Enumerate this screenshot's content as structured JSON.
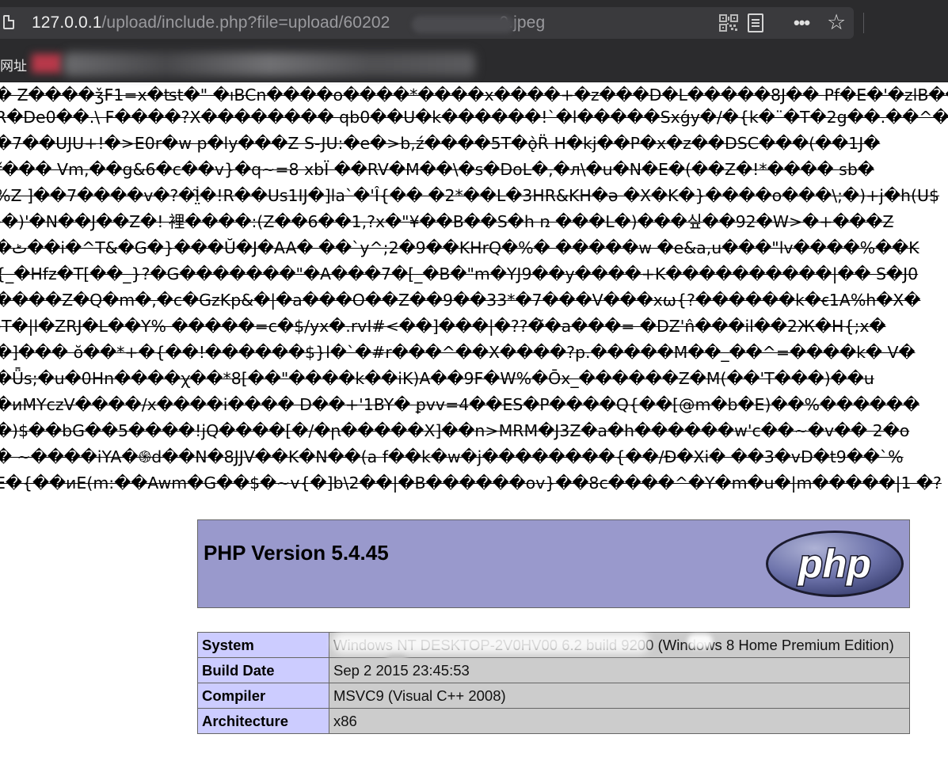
{
  "browser": {
    "url_host": "127.0.0.1",
    "url_path": "/upload/include.php?file=upload/60202",
    "url_suffix": "0.jpeg",
    "bookmarks_label": "网址",
    "more_glyph": "•••",
    "star_glyph": "☆"
  },
  "garbage_lines": [
    "� Z����ǯF1=x�ʦt�\" �ıBCn����o����*����x����+�z���D�L�����8J�� Pf�E�'�zlB����ZO",
    "R�De0��.\\ F����?X�������� qb0��U�k������!`�l�����Sxǵy�/�{k�¨�T�2g��.��^�",
    "�7��UJU+!�>E0r�w p�ly���Z S-JU:�e�>b,ź����5T�ǫ̀R̈ H�kj��P�x�z��DSC���(��1J�",
    "ř��� Vm,��g&6�c��v}�q~=8 xbÏ ��RV�M��\\�s�DoL�,�л\\�u�N�E�(��Z�!*���� sb�",
    "%Z ]��7����v�?�İ̤̃�!R��Us1IJ�]la`�'Î{�� �2*��L�3HR&KH�ə �X�K�}����o���\\;�)+j�h(U$",
    ")�)'�N��J��Z�! 裡����:(Z��6��1,?x�\"¥��B��S�h ռ ���L�)���싶��92�W>�+���Z",
    "�ٹ��i�^T&�G�}���Ŭ�J�AA� ��`y^;2�9��KHrQ�%� �����w �e&a,u���\"lv����%��K",
    "{_�Hfz�T[��_}?�G�������\"�A���7�[_�B�\"m�YJ9��y����+K����������|�� S�J0",
    "����Z�Q�m�,�c�GzKp&�|�a���O��Z��9��33*�7���V���xω{?������k�ꞓ1A%h�X�",
    ")T�|l�ZRJ�L��Y% �����=c�$/yx�.rvI#<��]���|�??�̃�a���= �DZ'n̂���il��2Ж�H{;x�",
    "�]��� ŏ��*+�{��!������$}l�`�#r���^��X����?p.�����M��_��^=����k� V�",
    "�Ǖs;�u�0Hn����ꭓ��*8[��\"����k��iK)A��9F�W%�Ōx_������Z�M(��'T���)��u",
    "�ᴎMYczV����/x����i���� D��+'1BY� ꝑvv=4��ES�P����Q{��[@m�b�E)��%������",
    "�)$��bG��5����!jQ����[�/�ꞃ�����X]��n>MRM�J3Z�a�h������w'c��~�v�� 2�o",
    "� ~����iYA�֍d��N�8JJV��K�N��(a f��k�w�j��������{��/Ɖ�Xi� ��3�vD�t9��`%",
    "E�{��иE(m:��Awm�G��$�~v{�]b\\2��|�B������ov}��8c����^�Y�m�u�|m�����|1 �?"
  ],
  "php_header": {
    "title": "PHP Version 5.4.45",
    "logo_text": "php"
  },
  "info_rows": [
    {
      "label": "System",
      "value": "Windows NT DESKTOP-2V0HV00 6.2 build 9200 (Windows 8 Home Premium Edition)"
    },
    {
      "label": "Build Date",
      "value": "Sep 2 2015 23:45:53"
    },
    {
      "label": "Compiler",
      "value": "MSVC9 (Visual C++ 2008)"
    },
    {
      "label": "Architecture",
      "value": "x86"
    }
  ],
  "colors": {
    "chrome_bg": "#2b2b2d",
    "urlbar_bg": "#3a3a3d",
    "php_header_bg": "#9999cc",
    "label_cell_bg": "#ccccff",
    "value_cell_bg": "#cccccc"
  },
  "icons": [
    "page-icon",
    "qr-code-icon",
    "reader-mode-icon",
    "more-icon",
    "star-icon",
    "php-logo"
  ]
}
